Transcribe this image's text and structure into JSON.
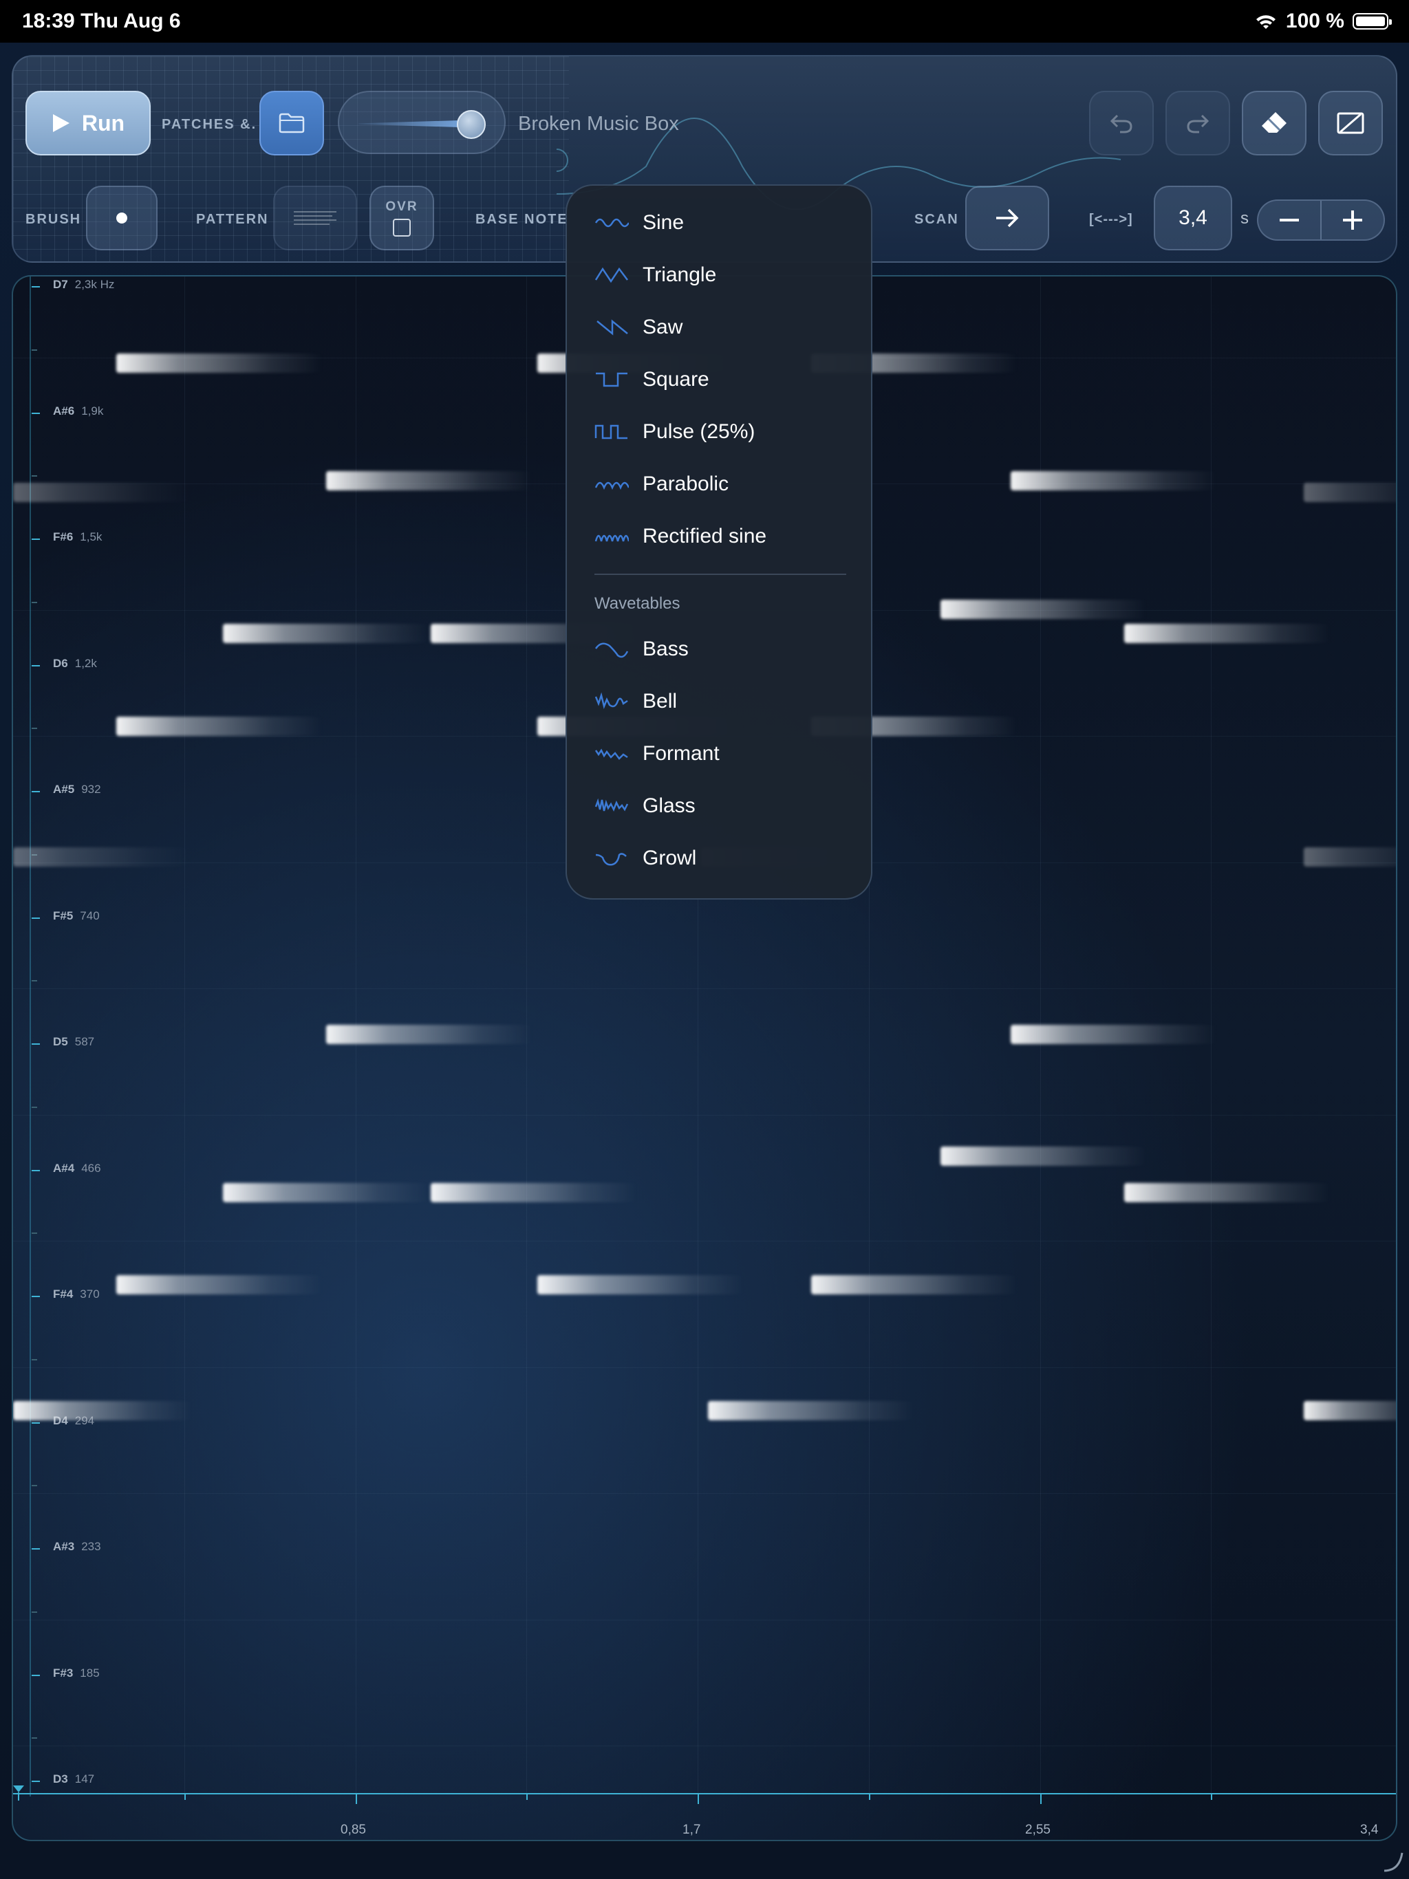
{
  "status_bar": {
    "time": "18:39  Thu Aug 6",
    "battery": "100 %"
  },
  "toolbar": {
    "run_label": "Run",
    "patches_label": "PATCHES &.",
    "patch_name": "Broken Music Box",
    "brush_label": "BRUSH",
    "pattern_label": "PATTERN",
    "ovr_label": "OVR",
    "base_note_label": "BASE NOTE",
    "scan_label": "SCAN",
    "range_label": "[<--->]",
    "duration_value": "3,4",
    "duration_unit": "s",
    "volume_level": 0.8
  },
  "waveform_menu": {
    "items": [
      "Sine",
      "Triangle",
      "Saw",
      "Square",
      "Pulse (25%)",
      "Parabolic",
      "Rectified sine"
    ],
    "wavetables_header": "Wavetables",
    "wavetables": [
      "Bass",
      "Bell",
      "Formant",
      "Glass",
      "Growl"
    ]
  },
  "canvas": {
    "pitch_labels": [
      {
        "note": "D7",
        "freq": "2,3k Hz"
      },
      {
        "note": "A#6",
        "freq": "1,9k"
      },
      {
        "note": "F#6",
        "freq": "1,5k"
      },
      {
        "note": "D6",
        "freq": "1,2k"
      },
      {
        "note": "A#5",
        "freq": "932"
      },
      {
        "note": "F#5",
        "freq": "740"
      },
      {
        "note": "D5",
        "freq": "587"
      },
      {
        "note": "A#4",
        "freq": "466"
      },
      {
        "note": "F#4",
        "freq": "370"
      },
      {
        "note": "D4",
        "freq": "294"
      },
      {
        "note": "A#3",
        "freq": "233"
      },
      {
        "note": "F#3",
        "freq": "185"
      },
      {
        "note": "D3",
        "freq": "147"
      }
    ],
    "time_labels": [
      "0,85",
      "1,7",
      "2,55",
      "3,4"
    ],
    "colors": {
      "accent": "#3fb4d6",
      "menu_icon": "#3d7bd6"
    }
  }
}
